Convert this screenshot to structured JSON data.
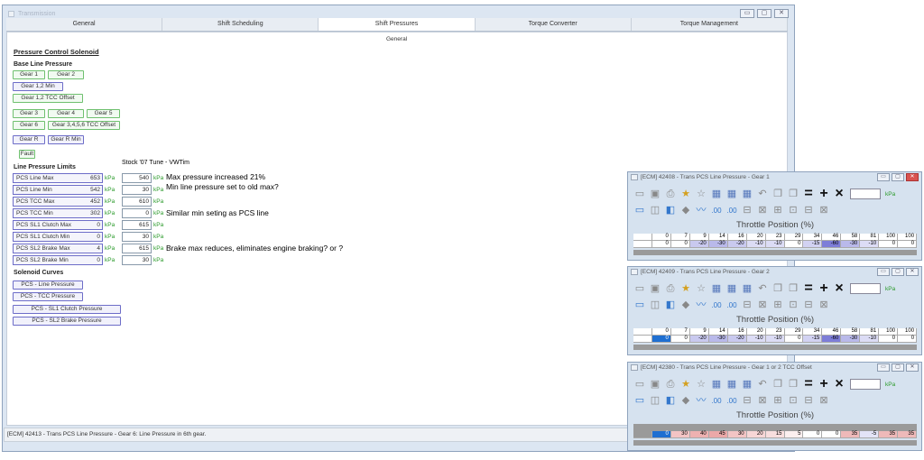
{
  "window": {
    "title": "Transmission",
    "controls": [
      "▭",
      "▢",
      "✕"
    ]
  },
  "tabs": [
    "General",
    "Shift Scheduling",
    "Shift Pressures",
    "Torque Converter",
    "Torque Management"
  ],
  "active_tab": "Shift Pressures",
  "subtab": "General",
  "sections": {
    "pcs": "Pressure Control Solenoid",
    "base_line": "Base Line Pressure",
    "limits": "Line Pressure Limits",
    "curves": "Solenoid Curves"
  },
  "base_buttons": {
    "gear1": "Gear 1",
    "gear2": "Gear 2",
    "gear12min": "Gear 1,2 Min",
    "gear12tcc": "Gear 1,2 TCC Offset",
    "gear3": "Gear 3",
    "gear4": "Gear 4",
    "gear5": "Gear 5",
    "gear6": "Gear 6",
    "gear3456tcc": "Gear 3,4,5,6 TCC Offset",
    "gearR": "Gear R",
    "gearRmin": "Gear R Min",
    "fault": "Fault"
  },
  "stock_label": "Stock '07",
  "tune_label": "Tune - VWTim",
  "unit": "kPa",
  "limits": [
    {
      "label": "PCS Line Max",
      "stock": "653",
      "tune": "540",
      "note": "Max pressure increased 21%"
    },
    {
      "label": "PCS Line Min",
      "stock": "542",
      "tune": "30",
      "note": "Min line pressure set to old max?"
    },
    {
      "label": "PCS TCC Max",
      "stock": "452",
      "tune": "610",
      "note": ""
    },
    {
      "label": "PCS TCC Min",
      "stock": "302",
      "tune": "0",
      "note": "Similar min seting as PCS line"
    },
    {
      "label": "PCS SL1 Clutch Max",
      "stock": "0",
      "tune": "615",
      "note": ""
    },
    {
      "label": "PCS SL1 Clutch Min",
      "stock": "0",
      "tune": "30",
      "note": ""
    },
    {
      "label": "PCS SL2 Brake Max",
      "stock": "4",
      "tune": "615",
      "note": "Brake max reduces, eliminates engine braking? or ?"
    },
    {
      "label": "PCS SL2 Brake Min",
      "stock": "0",
      "tune": "30",
      "note": ""
    }
  ],
  "curves": {
    "line": "PCS - Line Pressure",
    "tcc": "PCS - TCC Pressure",
    "sl1": "PCS - SL1 Clutch Pressure",
    "sl2": "PCS - SL2 Brake Pressure"
  },
  "status": "[ECM] 42413 - Trans PCS Line Pressure - Gear 6: Line Pressure in 6th gear.",
  "popups": [
    {
      "title": "[ECM] 42408 - Trans PCS Line Pressure - Gear 1",
      "axis_title": "Throttle Position (%)",
      "kpa": "kPa",
      "header": [
        "0",
        "7",
        "9",
        "14",
        "16",
        "20",
        "23",
        "29",
        "34",
        "46",
        "58",
        "81",
        "100",
        "100"
      ],
      "values": [
        "0",
        "0",
        "-20",
        "-30",
        "-20",
        "-10",
        "-10",
        "0",
        "-15",
        "-60",
        "-30",
        "-10",
        "0",
        "0"
      ],
      "colors": [
        "#ffffff",
        "#ffffff",
        "#c9c9ef",
        "#b9b9ea",
        "#c9c9ef",
        "#dcdcf5",
        "#dcdcf5",
        "#ffffff",
        "#d2d2f2",
        "#7d7dd8",
        "#b9b9ea",
        "#dcdcf5",
        "#ffffff",
        "#ffffff"
      ]
    },
    {
      "title": "[ECM] 42409 - Trans PCS Line Pressure - Gear 2",
      "axis_title": "Throttle Position (%)",
      "kpa": "kPa",
      "header": [
        "0",
        "7",
        "9",
        "14",
        "16",
        "20",
        "23",
        "29",
        "34",
        "46",
        "58",
        "81",
        "100",
        "100"
      ],
      "values": [
        "0",
        "0",
        "-20",
        "-30",
        "-20",
        "-10",
        "-10",
        "0",
        "-15",
        "-60",
        "-30",
        "-10",
        "0",
        "0"
      ],
      "colors": [
        "#1f6fd1",
        "#ffffff",
        "#c9c9ef",
        "#b9b9ea",
        "#c9c9ef",
        "#dcdcf5",
        "#dcdcf5",
        "#ffffff",
        "#d2d2f2",
        "#7d7dd8",
        "#b9b9ea",
        "#dcdcf5",
        "#ffffff",
        "#ffffff"
      ]
    },
    {
      "title": "[ECM] 42380 - Trans PCS Line Pressure - Gear 1 or 2 TCC Offset",
      "axis_title": "Throttle Position (%)",
      "kpa": "kPa",
      "header": [],
      "values": [
        "0",
        "30",
        "40",
        "45",
        "30",
        "20",
        "15",
        "5",
        "0",
        "0",
        "35",
        "-5",
        "35",
        "35"
      ],
      "colors": [
        "#1f6fd1",
        "#f3c4c4",
        "#eeb1b1",
        "#eba8a8",
        "#f3c4c4",
        "#f7d6d6",
        "#f8dede",
        "#fcefef",
        "#ffffff",
        "#ffffff",
        "#eeb9b9",
        "#e3e3f7",
        "#eeb9b9",
        "#eeb9b9"
      ]
    }
  ]
}
